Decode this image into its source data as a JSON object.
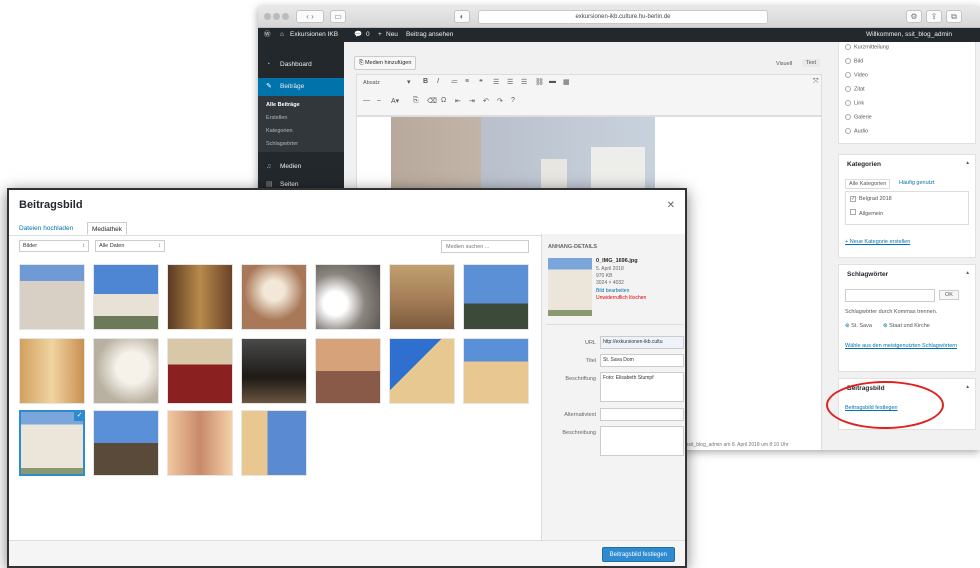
{
  "browser": {
    "url": "exkursionen-ikb.culture.hu-berlin.de",
    "adminbar": {
      "site": "Exkursionen IKB",
      "comments": "0",
      "new": "Neu",
      "view": "Beitrag ansehen",
      "welcome": "Willkommen, ssit_blog_admin"
    }
  },
  "sidebar": {
    "items": [
      {
        "label": "Dashboard",
        "icon": "dashboard-icon"
      },
      {
        "label": "Beiträge",
        "icon": "pin-icon"
      },
      {
        "label": "Medien",
        "icon": "media-icon"
      },
      {
        "label": "Seiten",
        "icon": "page-icon"
      }
    ],
    "submenu": [
      "Alle Beiträge",
      "Erstellen",
      "Kategorien",
      "Schlagwörter"
    ]
  },
  "editor": {
    "add_media": "Medien hinzufügen",
    "tab_visual": "Visuell",
    "tab_text": "Text",
    "format": "Absatz",
    "status_line": "ssit_blog_admin am 8. April 2018 um 8:10 Uhr"
  },
  "formats": {
    "items": [
      "Kurzmitteilung",
      "Bild",
      "Video",
      "Zitat",
      "Link",
      "Galerie",
      "Audio"
    ]
  },
  "categories": {
    "title": "Kategorien",
    "tab_all": "Alle Kategorien",
    "tab_used": "Häufig genutzt",
    "items": [
      {
        "label": "Belgrad 2018",
        "checked": true
      },
      {
        "label": "Allgemein",
        "checked": false
      }
    ],
    "add_link": "+ Neue Kategorie erstellen"
  },
  "tags": {
    "title": "Schlagwörter",
    "add_button": "OK",
    "hint": "Schlagwörter durch Kommas trennen.",
    "items": [
      "St. Sava",
      "Staat und Kirche"
    ],
    "choose_link": "Wähle aus den meistgenutzten Schlagwörtern"
  },
  "featured": {
    "title": "Beitragsbild",
    "link": "Beitragsbild festlegen"
  },
  "modal": {
    "title": "Beitragsbild",
    "tab_upload": "Dateien hochladen",
    "tab_library": "Mediathek",
    "filter_type": "Bilder",
    "filter_date": "Alle Daten",
    "search_placeholder": "Medien suchen ...",
    "details_heading": "ANHANG-DETAILS",
    "file_name": "0_IMG_1696.jpg",
    "file_date": "5. April 2018",
    "file_size": "970 KB",
    "file_dims": "3024 × 4032",
    "edit_link": "Bild bearbeiten",
    "delete_link": "Unwiderruflich löschen",
    "fields": [
      {
        "label": "URL",
        "value": "http://exkursionen-ikb.cultu"
      },
      {
        "label": "Titel",
        "value": "St. Sava Dom"
      },
      {
        "label": "Beschriftung",
        "value": "Foto: Elisabeth Stumpf"
      },
      {
        "label": "Alternativtext",
        "value": ""
      },
      {
        "label": "Beschreibung",
        "value": ""
      }
    ],
    "set_button": "Beitragsbild festlegen",
    "selected_index": 14
  },
  "colors": {
    "admin_dark": "#23282d",
    "accent_blue": "#0073aa",
    "button_blue": "#2e8bcf",
    "highlight_red": "#e02020"
  }
}
